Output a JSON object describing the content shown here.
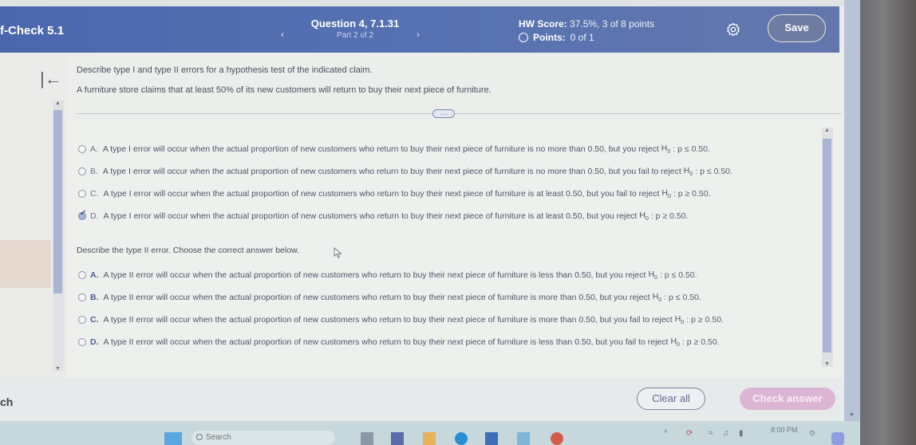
{
  "header": {
    "assignment_title": "f-Check 5.1",
    "prev_icon": "chevron-left-icon",
    "next_icon": "chevron-right-icon",
    "question_title": "Question 4, 7.1.31",
    "question_part": "Part 2 of 2",
    "hw_score_label": "HW Score:",
    "hw_score_value": "37.5%, 3 of 8 points",
    "points_label": "Points:",
    "points_value": "0 of 1",
    "settings_icon": "gear-icon",
    "save_label": "Save"
  },
  "left_pane": {
    "collapse_icon": "collapse-left-icon",
    "collapse_glyph": "|←"
  },
  "question": {
    "prompt": "Describe type I and type II errors for a hypothesis test of the indicated claim.",
    "claim": "A furniture store claims that at least 50% of its new customers will return to buy their next piece of furniture.",
    "more_label": "....",
    "type1_options": [
      {
        "letter": "A.",
        "text": "A type I error will occur when the actual proportion of new customers who return to buy their next piece of furniture is no more than 0.50, but you reject",
        "h0": "H",
        "h0_sub": "0",
        "tail": ": p ≤ 0.50.",
        "selected": false
      },
      {
        "letter": "B.",
        "text": "A type I error will occur when the actual proportion of new customers who return to buy their next piece of furniture is no more than 0.50, but you fail to reject",
        "h0": "H",
        "h0_sub": "0",
        "tail": ": p ≤ 0.50.",
        "selected": false
      },
      {
        "letter": "C.",
        "text": "A type I error will occur when the actual proportion of new customers who return to buy their next piece of furniture is at least 0.50, but you fail to reject",
        "h0": "H",
        "h0_sub": "0",
        "tail": ": p ≥ 0.50.",
        "selected": false
      },
      {
        "letter": "D.",
        "text": "A type I error will occur when the actual proportion of new customers who return to buy their next piece of furniture is at least 0.50, but you reject",
        "h0": "H",
        "h0_sub": "0",
        "tail": ": p ≥ 0.50.",
        "selected": true
      }
    ],
    "type2_prompt": "Describe the type II error. Choose the correct answer below.",
    "type2_options": [
      {
        "letter": "A.",
        "text": "A type II error will occur when the actual proportion of new customers who return to buy their next piece of furniture is less than 0.50, but you reject",
        "h0": "H",
        "h0_sub": "0",
        "tail": ": p ≤ 0.50.",
        "selected": false
      },
      {
        "letter": "B.",
        "text": "A type II error will occur when the actual proportion of new customers who return to buy their next piece of furniture is more than 0.50, but you reject",
        "h0": "H",
        "h0_sub": "0",
        "tail": ": p ≤ 0.50.",
        "selected": false
      },
      {
        "letter": "C.",
        "text": "A type II error will occur when the actual proportion of new customers who return to buy their next piece of furniture is more than 0.50, but you fail to reject",
        "h0": "H",
        "h0_sub": "0",
        "tail": ": p ≥ 0.50.",
        "selected": false
      },
      {
        "letter": "D.",
        "text": "A type II error will occur when the actual proportion of new customers who return to buy their next piece of furniture is less than 0.50, but you fail to reject",
        "h0": "H",
        "h0_sub": "0",
        "tail": ": p ≥ 0.50.",
        "selected": false
      }
    ]
  },
  "footer": {
    "left_text": "ch",
    "clear_label": "Clear all",
    "check_label": "Check answer",
    "check_color": "#dcb5d4"
  },
  "taskbar": {
    "search_placeholder": "Search",
    "time": "8:00 PM",
    "icons": [
      "windows-start-icon",
      "search-icon",
      "task-view-icon",
      "teams-icon",
      "file-explorer-icon",
      "edge-icon",
      "store-icon",
      "snipping-tool-icon",
      "chrome-icon",
      "tray-chevron-icon",
      "wifi-icon",
      "volume-icon",
      "battery-icon",
      "notification-bell-icon",
      "copilot-icon"
    ]
  },
  "colors": {
    "header_blue": "#5672b2",
    "scroll_thumb": "#a9b5d2"
  }
}
